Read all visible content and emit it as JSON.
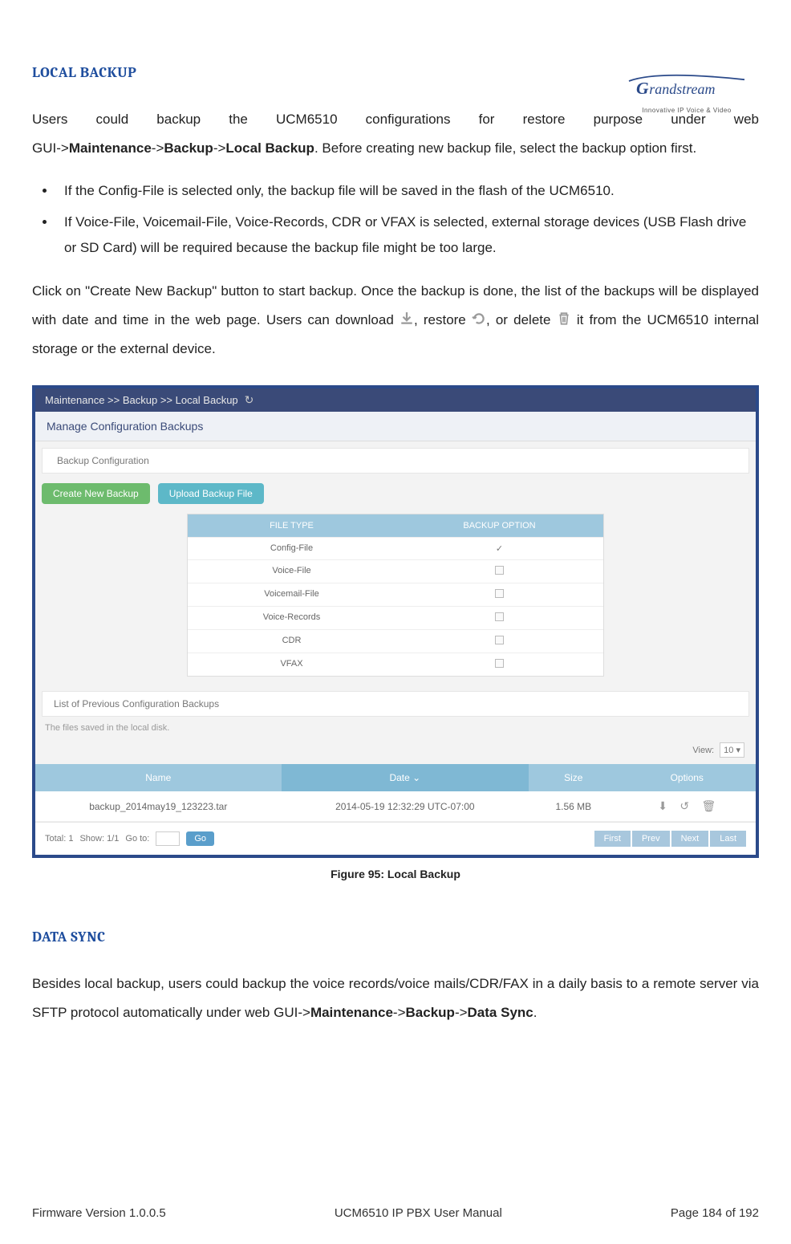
{
  "logo": {
    "name": "Grandstream",
    "tagline": "Innovative IP Voice & Video"
  },
  "heading1": "LOCAL BACKUP",
  "intro": {
    "line1": "Users could backup the UCM6510 configurations for restore purpose under web",
    "line2_pre": "GUI->",
    "line2_b1": "Maintenance",
    "line2_m1": "->",
    "line2_b2": "Backup",
    "line2_m2": "->",
    "line2_b3": "Local Backup",
    "line2_post": ". Before creating new backup file, select the backup option first."
  },
  "bullets": [
    "If the Config-File is selected only, the backup file will be saved in the flash of the UCM6510.",
    "If Voice-File, Voicemail-File, Voice-Records, CDR or VFAX is selected, external storage devices (USB Flash drive or SD Card) will be required because the backup file might be too large."
  ],
  "para2": {
    "pre": "Click on \"Create New Backup\" button to start backup. Once the backup is done, the list of the backups will be displayed with date and time in the web page. Users can download ",
    "mid1": ", restore ",
    "mid2": ", or delete ",
    "post": " it from the UCM6510 internal storage or the external device."
  },
  "screenshot": {
    "breadcrumb": "Maintenance >> Backup >> Local Backup",
    "title": "Manage Configuration Backups",
    "subtitle": "Backup Configuration",
    "buttons": {
      "create": "Create New Backup",
      "upload": "Upload Backup File"
    },
    "cfg_table": {
      "headers": [
        "FILE TYPE",
        "BACKUP OPTION"
      ],
      "rows": [
        {
          "label": "Config-File",
          "checked": true
        },
        {
          "label": "Voice-File",
          "checked": false
        },
        {
          "label": "Voicemail-File",
          "checked": false
        },
        {
          "label": "Voice-Records",
          "checked": false
        },
        {
          "label": "CDR",
          "checked": false
        },
        {
          "label": "VFAX",
          "checked": false
        }
      ]
    },
    "list_section": "List of Previous Configuration Backups",
    "note": "The files saved in the local disk.",
    "view_label": "View:",
    "view_value": "10",
    "list_table": {
      "headers": [
        "Name",
        "Date ⌄",
        "Size",
        "Options"
      ],
      "row": {
        "name": "backup_2014may19_123223.tar",
        "date": "2014-05-19 12:32:29 UTC-07:00",
        "size": "1.56 MB"
      }
    },
    "footer": {
      "total": "Total: 1",
      "show": "Show: 1/1",
      "goto": "Go to:",
      "go": "Go",
      "pager": [
        "First",
        "Prev",
        "Next",
        "Last"
      ]
    }
  },
  "figure_caption": "Figure 95: Local Backup",
  "heading2": "DATA SYNC",
  "para3": {
    "pre": "Besides local backup, users could backup the voice records/voice mails/CDR/FAX in a daily basis to a remote server via SFTP protocol automatically under web GUI->",
    "b1": "Maintenance",
    "m1": "->",
    "b2": "Backup",
    "m2": "->",
    "b3": "Data Sync",
    "post": "."
  },
  "footer": {
    "left": "Firmware Version 1.0.0.5",
    "center": "UCM6510 IP PBX User Manual",
    "right": "Page 184 of 192"
  }
}
